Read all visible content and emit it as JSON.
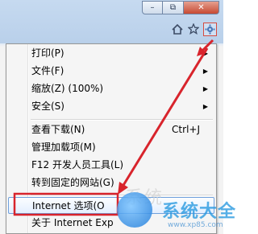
{
  "window_controls": {
    "minimize": "–",
    "restore": "⧉",
    "close": "✕"
  },
  "toolbar": {
    "home_icon": "home-icon",
    "favorites_icon": "star-icon",
    "tools_icon": "gear-icon"
  },
  "menu": {
    "items": [
      {
        "label": "打印(P)",
        "submenu": true
      },
      {
        "label": "文件(F)",
        "submenu": true
      },
      {
        "label": "缩放(Z) (100%)",
        "submenu": true
      },
      {
        "label": "安全(S)",
        "submenu": true
      },
      {
        "label": "查看下载(N)",
        "shortcut": "Ctrl+J"
      },
      {
        "label": "管理加载项(M)"
      },
      {
        "label": "F12 开发人员工具(L)"
      },
      {
        "label": "转到固定的网站(G)"
      },
      {
        "label": "Internet 选项(O",
        "highlighted": true
      },
      {
        "label": "关于 Internet Exp"
      }
    ]
  },
  "watermark": {
    "brand": "系统大全",
    "ghost_text": "系统",
    "url": "www.xp85.com"
  },
  "colors": {
    "annotation": "#d8242c",
    "highlight_border": "#6fa0dc",
    "menu_bg": "#f5f5f5"
  }
}
